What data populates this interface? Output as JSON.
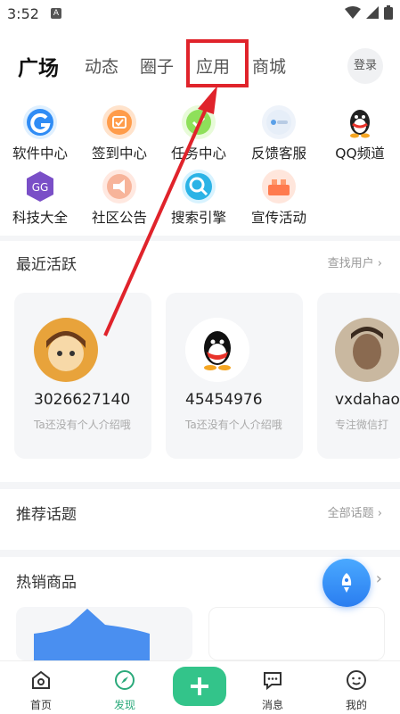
{
  "status": {
    "time": "3:52",
    "badge": "A"
  },
  "tabs": [
    {
      "label": "广场"
    },
    {
      "label": "动态"
    },
    {
      "label": "圈子"
    },
    {
      "label": "应用"
    },
    {
      "label": "商城"
    }
  ],
  "header": {
    "login_label": "登录"
  },
  "apps": [
    {
      "label": "软件中心",
      "icon": "software-center-icon"
    },
    {
      "label": "签到中心",
      "icon": "checkin-icon"
    },
    {
      "label": "任务中心",
      "icon": "task-icon"
    },
    {
      "label": "反馈客服",
      "icon": "feedback-icon"
    },
    {
      "label": "QQ频道",
      "icon": "qq-icon"
    },
    {
      "label": "科技大全",
      "icon": "tech-icon"
    },
    {
      "label": "社区公告",
      "icon": "announcement-icon"
    },
    {
      "label": "搜索引擎",
      "icon": "search-engine-icon"
    },
    {
      "label": "宣传活动",
      "icon": "promo-icon"
    }
  ],
  "recent": {
    "title": "最近活跃",
    "more": "查找用户",
    "users": [
      {
        "name": "3026627140",
        "intro": "Ta还没有个人介绍哦"
      },
      {
        "name": "45454976",
        "intro": "Ta还没有个人介绍哦"
      },
      {
        "name": "vxdahao",
        "intro": "专注微信打"
      }
    ]
  },
  "topics": {
    "title": "推荐话题",
    "more": "全部话题"
  },
  "hot": {
    "title": "热销商品"
  },
  "bottom_nav": [
    {
      "label": "首页",
      "icon": "home-icon"
    },
    {
      "label": "发现",
      "icon": "compass-icon"
    },
    {
      "label": "消息",
      "icon": "message-icon"
    },
    {
      "label": "我的",
      "icon": "profile-icon"
    }
  ],
  "colors": {
    "accent": "#33c48a",
    "highlight": "#e0232b",
    "fab": "#2a7df0"
  }
}
